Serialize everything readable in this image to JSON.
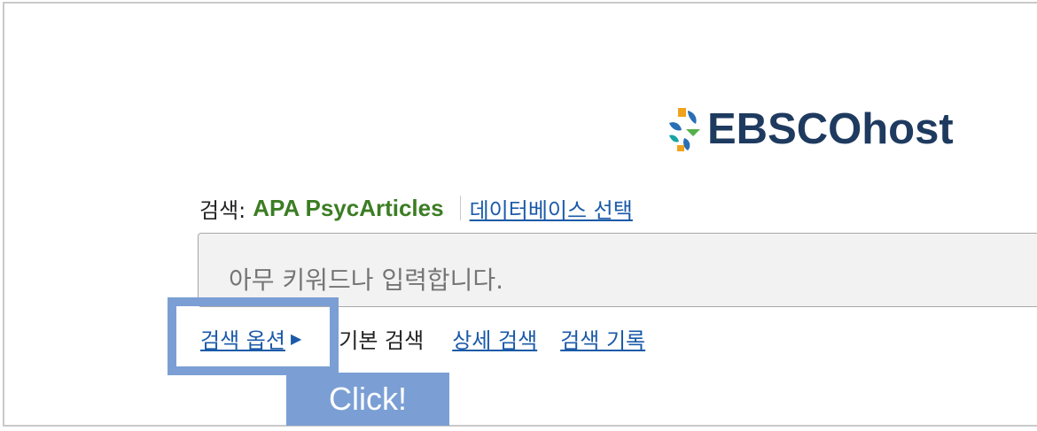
{
  "logo": {
    "text": "EBSCOhost"
  },
  "search": {
    "prefix": "검색:",
    "database": "APA PsycArticles",
    "select_database": "데이터베이스 선택",
    "placeholder": "아무 키워드나 입력합니다."
  },
  "options": {
    "search_options": "검색 옵션",
    "basic_search": "기본 검색",
    "advanced_search": "상세 검색",
    "search_history": "검색 기록"
  },
  "annotation": {
    "label": "Click!",
    "color": "#7b9fd4"
  },
  "colors": {
    "link": "#1a5aa8",
    "database": "#3c7d24",
    "logo_text": "#1e3a5f"
  }
}
